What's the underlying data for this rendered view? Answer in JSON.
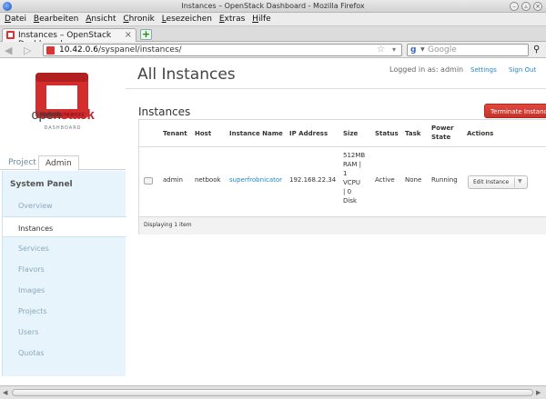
{
  "window": {
    "title": "Instances – OpenStack Dashboard - Mozilla Firefox"
  },
  "menu": [
    "Datei",
    "Bearbeiten",
    "Ansicht",
    "Chronik",
    "Lesezeichen",
    "Extras",
    "Hilfe"
  ],
  "browser_tab": {
    "label": "Instances – OpenStack Dashboard",
    "new_tab": "+"
  },
  "address": {
    "host": "10.42.0.6",
    "path": "/syspanel/instances/"
  },
  "search": {
    "placeholder": "Google"
  },
  "logo": {
    "word_open": "open",
    "word_stack": "stack",
    "subtitle": "DASHBOARD"
  },
  "sidebar": {
    "tabs": [
      "Project",
      "Admin"
    ],
    "active_tab": "Admin",
    "panel_title": "System Panel",
    "items": [
      "Overview",
      "Instances",
      "Services",
      "Flavors",
      "Images",
      "Projects",
      "Users",
      "Quotas"
    ],
    "active_item": "Instances"
  },
  "header": {
    "title": "All Instances",
    "logged_in": "Logged in as: admin",
    "settings": "Settings",
    "sign_out": "Sign Out"
  },
  "instances": {
    "title": "Instances",
    "terminate_label": "Terminate Instances",
    "columns": [
      "Tenant",
      "Host",
      "Instance Name",
      "IP Address",
      "Size",
      "Status",
      "Task",
      "Power State",
      "Actions"
    ],
    "rows": [
      {
        "tenant": "admin",
        "host": "netbook",
        "name": "superfrobnicator",
        "ip": "192.168.22.34",
        "size_lines": [
          "512MB",
          "RAM |",
          "1",
          "VCPU",
          "| 0",
          "Disk"
        ],
        "status": "Active",
        "task": "None",
        "power": "Running",
        "action": "Edit Instance"
      }
    ],
    "footer": "Displaying 1 item"
  },
  "colors": {
    "accent_red": "#c8322b",
    "link_blue": "#1e88c7",
    "panel_bg": "#e8f4fb"
  }
}
